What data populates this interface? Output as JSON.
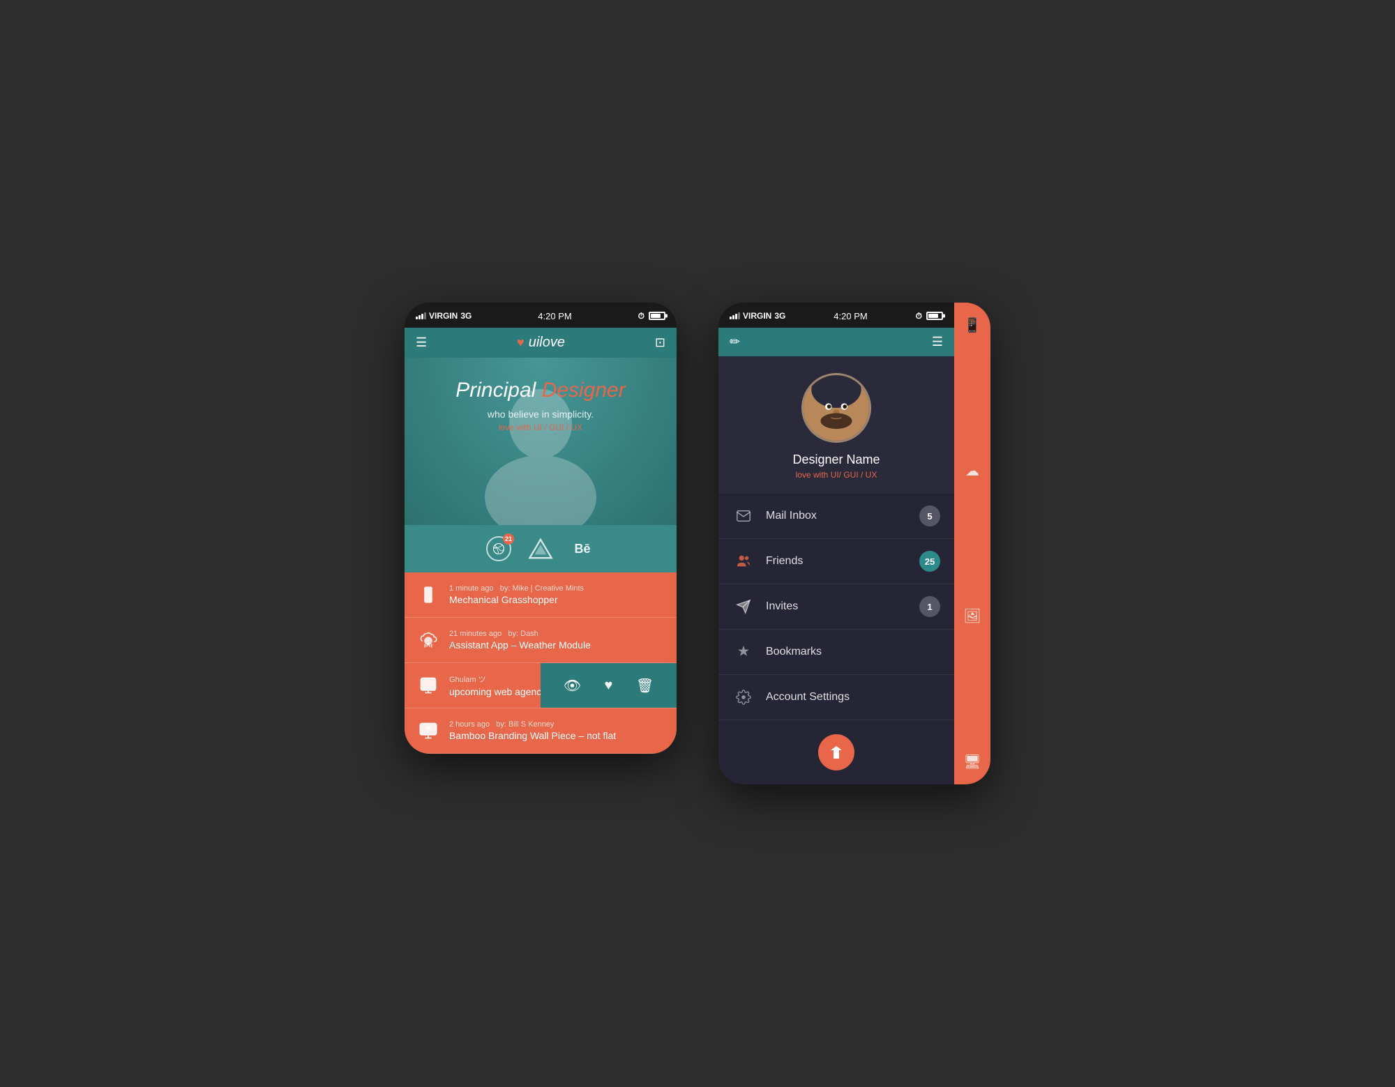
{
  "screen1": {
    "status": {
      "carrier": "VIRGIN",
      "network": "3G",
      "time": "4:20 PM"
    },
    "nav": {
      "logo": "uilove",
      "menu_label": "☰",
      "bag_label": "🎒"
    },
    "hero": {
      "line1_white": "Principal",
      "line1_coral": "Designer",
      "subtitle": "who believe in simplicity.",
      "tagline": "love with UI / GUI / UX"
    },
    "social": [
      {
        "id": "dribbble",
        "badge": "21"
      },
      {
        "id": "mountain",
        "badge": ""
      },
      {
        "id": "behance",
        "badge": ""
      }
    ],
    "feed": [
      {
        "icon": "phone",
        "time": "1 minute ago",
        "author": "by: Mike | Creative Mints",
        "title": "Mechanical Grasshopper"
      },
      {
        "icon": "cloud",
        "time": "21 minutes ago",
        "author": "by: Dash",
        "title": "Assistant App – Weather Module"
      },
      {
        "icon": "web",
        "time": "",
        "author": "Ghulam ツ",
        "title": "upcoming web agency",
        "swiped": true
      },
      {
        "icon": "monitor",
        "time": "2 hours ago",
        "author": "by: Bill S Kenney",
        "title": "Bamboo Branding Wall Piece – not flat"
      }
    ],
    "swipe_actions": [
      "👁",
      "♥",
      "🗑"
    ]
  },
  "screen2": {
    "status": {
      "carrier": "VIRGIN",
      "network": "3G",
      "time": "4:20 PM"
    },
    "profile": {
      "name": "Designer Name",
      "tagline": "love with UI/ GUI / UX"
    },
    "menu": [
      {
        "id": "mail",
        "label": "Mail Inbox",
        "badge": "5",
        "badge_type": "gray"
      },
      {
        "id": "friends",
        "label": "Friends",
        "badge": "25",
        "badge_type": "teal"
      },
      {
        "id": "invites",
        "label": "Invites",
        "badge": "1",
        "badge_type": "gray"
      },
      {
        "id": "bookmarks",
        "label": "Bookmarks",
        "badge": "",
        "badge_type": ""
      },
      {
        "id": "settings",
        "label": "Account Settings",
        "badge": "",
        "badge_type": ""
      }
    ],
    "logout_icon": "▲"
  }
}
